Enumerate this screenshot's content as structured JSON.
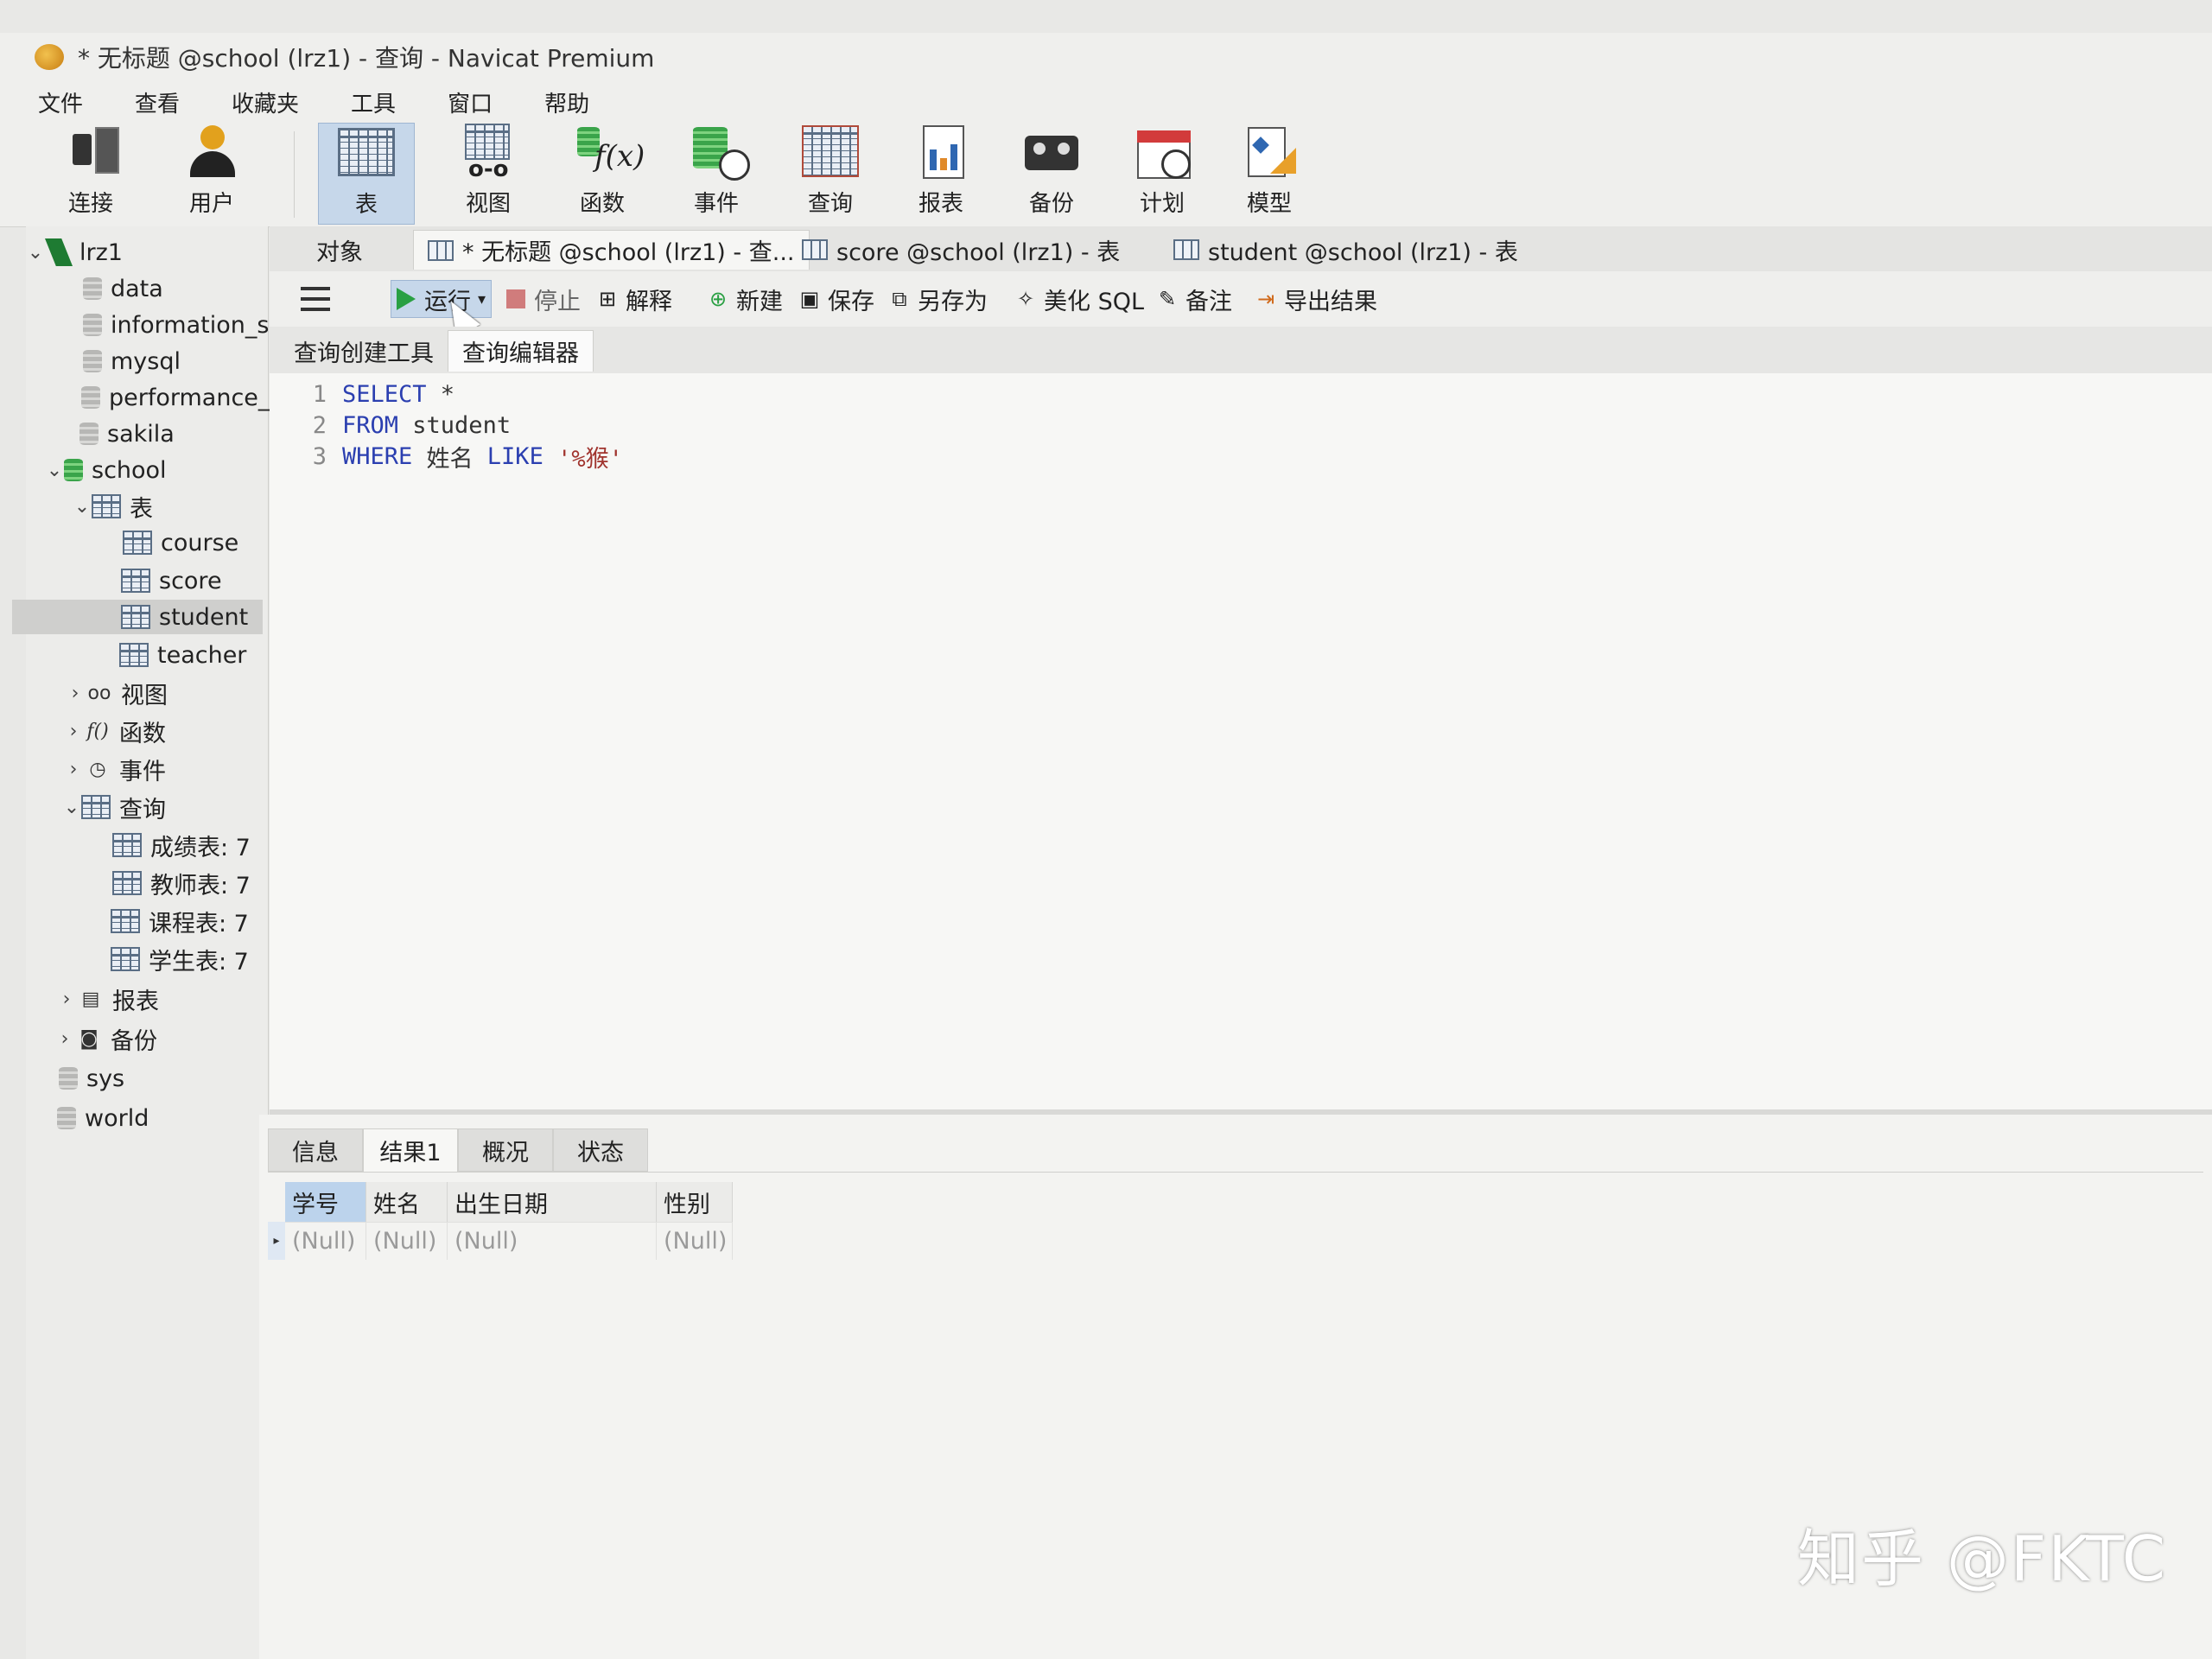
{
  "window": {
    "title": "* 无标题 @school (lrz1) - 查询 - Navicat Premium"
  },
  "menu": [
    "文件",
    "查看",
    "收藏夹",
    "工具",
    "窗口",
    "帮助"
  ],
  "toolbar": {
    "connect": "连接",
    "user": "用户",
    "table": "表",
    "view": "视图",
    "function": "函数",
    "event": "事件",
    "query": "查询",
    "report": "报表",
    "backup": "备份",
    "schedule": "计划",
    "model": "模型"
  },
  "sidebar": {
    "connection": "lrz1",
    "databases_top": [
      "data",
      "information_s",
      "mysql",
      "performance_",
      "sakila"
    ],
    "school": "school",
    "tables_group": "表",
    "tables": [
      "course",
      "score",
      "student",
      "teacher"
    ],
    "selected_table": "student",
    "views": "视图",
    "functions": "函数",
    "events": "事件",
    "queries": "查询",
    "query_items": [
      "成绩表: 7",
      "教师表: 7",
      "课程表: 7",
      "学生表: 7"
    ],
    "reports": "报表",
    "backups": "备份",
    "databases_bottom": [
      "sys",
      "world"
    ]
  },
  "tabs": {
    "objects": "对象",
    "items": [
      "* 无标题 @school (lrz1) - 查...",
      "score @school (lrz1) - 表",
      "student @school (lrz1) - 表"
    ]
  },
  "query_toolbar": {
    "run": "运行",
    "stop": "停止",
    "explain": "解释",
    "new": "新建",
    "save": "保存",
    "save_as": "另存为",
    "beautify": "美化 SQL",
    "comment": "备注",
    "export": "导出结果"
  },
  "subtabs": [
    "查询创建工具",
    "查询编辑器"
  ],
  "editor": {
    "line_numbers": [
      "1",
      "2",
      "3"
    ],
    "line1_kw": "SELECT",
    "line1_rest": " *",
    "line2_kw": "FROM",
    "line2_rest": " student",
    "line3_kw": "WHERE",
    "line3_col": " 姓名 ",
    "line3_like": "LIKE",
    "line3_str": " '%猴'"
  },
  "results": {
    "tabs": [
      "信息",
      "结果1",
      "概况",
      "状态"
    ],
    "active_tab": "结果1",
    "columns": [
      "学号",
      "姓名",
      "出生日期",
      "性别"
    ],
    "row": [
      "(Null)",
      "(Null)",
      "(Null)",
      "(Null)"
    ]
  },
  "watermark": "知乎 @FKTC"
}
